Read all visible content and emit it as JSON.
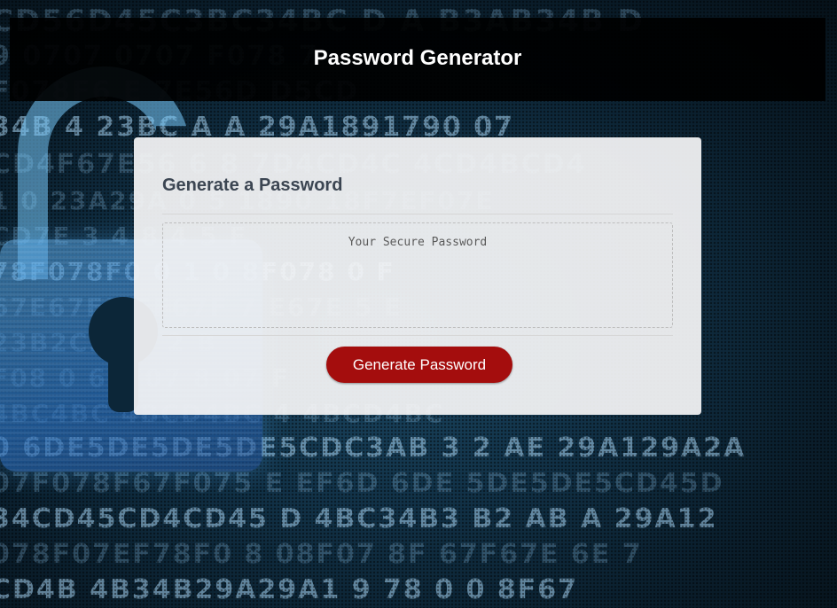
{
  "header": {
    "title": "Password Generator"
  },
  "card": {
    "title": "Generate a Password",
    "password_placeholder": "Your Secure Password",
    "password_value": "",
    "generate_button_label": "Generate Password"
  },
  "colors": {
    "header_bg": "#000000",
    "button_bg": "#a40d0d",
    "card_bg": "#f5f5f6"
  }
}
